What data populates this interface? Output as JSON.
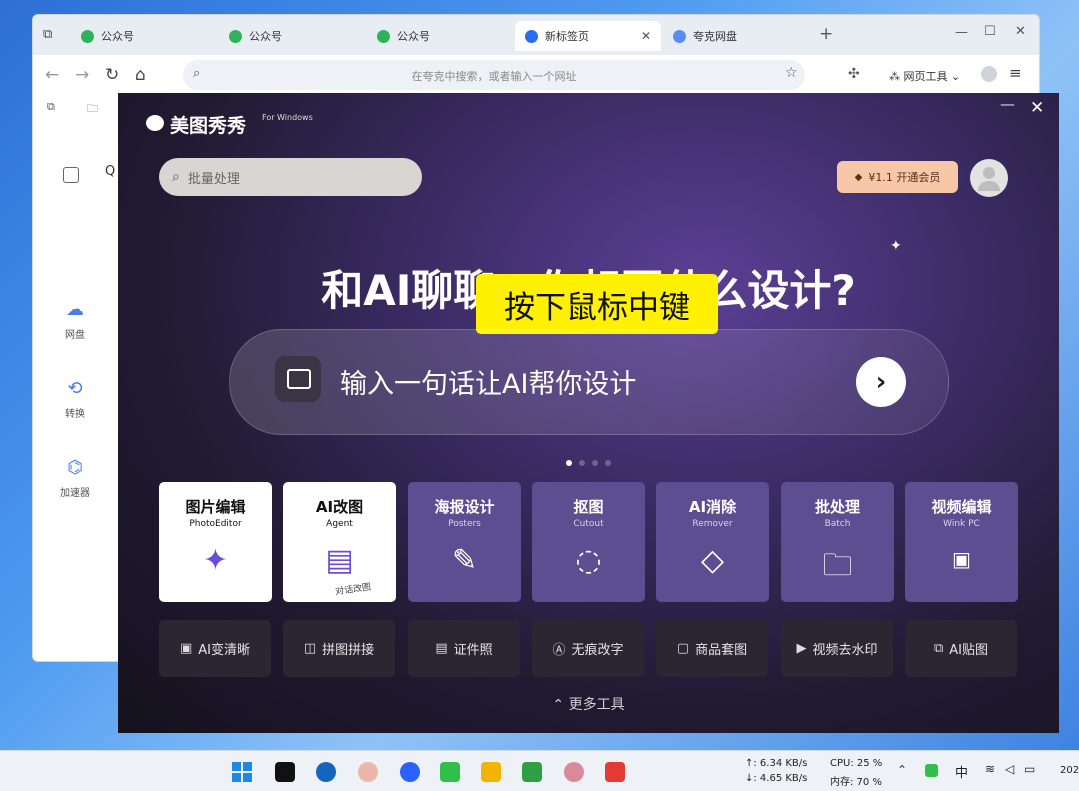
{
  "browser": {
    "tabs": [
      {
        "label": "公众号",
        "icon": "green-spiral-icon"
      },
      {
        "label": "公众号",
        "icon": "green-spiral-icon"
      },
      {
        "label": "公众号",
        "icon": "green-spiral-icon"
      },
      {
        "label": "新标签页",
        "icon": "blue-circle-icon"
      },
      {
        "label": "夸克网盘",
        "icon": "cloud-icon"
      }
    ],
    "new_tab": "+",
    "address_placeholder": "在夸克中搜索，或者输入一个网址",
    "web_tools": "网页工具",
    "sidebar": [
      {
        "label": "网盘"
      },
      {
        "label": "转换"
      },
      {
        "label": "加速器"
      }
    ]
  },
  "app": {
    "logo": "美图秀秀",
    "logo_sub": "For Windows",
    "search_placeholder": "批量处理",
    "vip": "¥1.1 开通会员",
    "headline": "和AI聊聊，你想要什么设计?",
    "overlay_caption": "按下鼠标中键",
    "prompt_placeholder": "输入一句话让AI帮你设计",
    "tools": [
      {
        "title": "图片编辑",
        "sub": "PhotoEditor",
        "icon": "magic-wand-icon",
        "style": "white"
      },
      {
        "title": "AI改图",
        "sub": "Agent",
        "icon": "chat-icon",
        "style": "white",
        "tag": "对话改图"
      },
      {
        "title": "海报设计",
        "sub": "Posters",
        "icon": "edit-icon",
        "style": "purple"
      },
      {
        "title": "抠图",
        "sub": "Cutout",
        "icon": "lasso-icon",
        "style": "purple"
      },
      {
        "title": "AI消除",
        "sub": "Remover",
        "icon": "eraser-icon",
        "style": "purple"
      },
      {
        "title": "批处理",
        "sub": "Batch",
        "icon": "folder-icon",
        "style": "purple"
      },
      {
        "title": "视频编辑",
        "sub": "Wink PC",
        "icon": "hd-icon",
        "style": "purple"
      }
    ],
    "small_tools": [
      {
        "label": "AI变清晰",
        "icon": "hd-icon"
      },
      {
        "label": "拼图拼接",
        "icon": "grid-icon"
      },
      {
        "label": "证件照",
        "icon": "id-card-icon"
      },
      {
        "label": "无痕改字",
        "icon": "text-icon"
      },
      {
        "label": "商品套图",
        "icon": "bag-icon"
      },
      {
        "label": "视频去水印",
        "icon": "video-icon"
      },
      {
        "label": "AI贴图",
        "icon": "sticker-icon"
      }
    ],
    "more_tools": "更多工具"
  },
  "taskbar": {
    "net_up": "↑: 6.34 KB/s",
    "net_down": "↓: 4.65 KB/s",
    "cpu": "CPU: 25 %",
    "mem": "内存: 70 %",
    "ime": "中",
    "clock": "202"
  }
}
